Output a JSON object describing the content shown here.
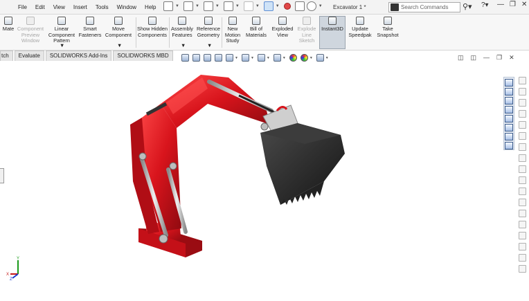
{
  "menu": {
    "items": [
      "File",
      "Edit",
      "View",
      "Insert",
      "Tools",
      "Window",
      "Help"
    ]
  },
  "document": {
    "title": "Excavator 1 *"
  },
  "search": {
    "placeholder": "Search Commands"
  },
  "ribbon": {
    "buttons": [
      {
        "label": "Mate",
        "icon": "mate-icon",
        "enabled": true
      },
      {
        "label": "Component Preview Window",
        "icon": "component-preview-icon",
        "enabled": false
      },
      {
        "label": "Linear Component Pattern",
        "icon": "linear-pattern-icon",
        "enabled": true
      },
      {
        "label": "Smart Fasteners",
        "icon": "smart-fasteners-icon",
        "enabled": true
      },
      {
        "label": "Move Component",
        "icon": "move-component-icon",
        "enabled": true
      },
      {
        "label": "Show Hidden Components",
        "icon": "show-hidden-icon",
        "enabled": true
      },
      {
        "label": "Assembly Features",
        "icon": "assembly-features-icon",
        "enabled": true
      },
      {
        "label": "Reference Geometry",
        "icon": "reference-geometry-icon",
        "enabled": true
      },
      {
        "label": "New Motion Study",
        "icon": "motion-study-icon",
        "enabled": true
      },
      {
        "label": "Bill of Materials",
        "icon": "bom-icon",
        "enabled": true
      },
      {
        "label": "Exploded View",
        "icon": "exploded-view-icon",
        "enabled": true
      },
      {
        "label": "Explode Line Sketch",
        "icon": "explode-line-icon",
        "enabled": false
      },
      {
        "label": "Instant3D",
        "icon": "instant3d-icon",
        "enabled": true,
        "active": true
      },
      {
        "label": "Update Speedpak",
        "icon": "speedpak-icon",
        "enabled": true
      },
      {
        "label": "Take Snapshot",
        "icon": "camera-icon",
        "enabled": true
      }
    ]
  },
  "tabs": [
    "tch",
    "Evaluate",
    "SOLIDWORKS Add-Ins",
    "SOLIDWORKS MBD"
  ],
  "model": {
    "body_color": "#d8141c",
    "bucket_color": "#2b2b2b",
    "steel_color": "#c8c8c8"
  },
  "triad": {
    "y": "Y",
    "x": "X",
    "z": "Z"
  }
}
